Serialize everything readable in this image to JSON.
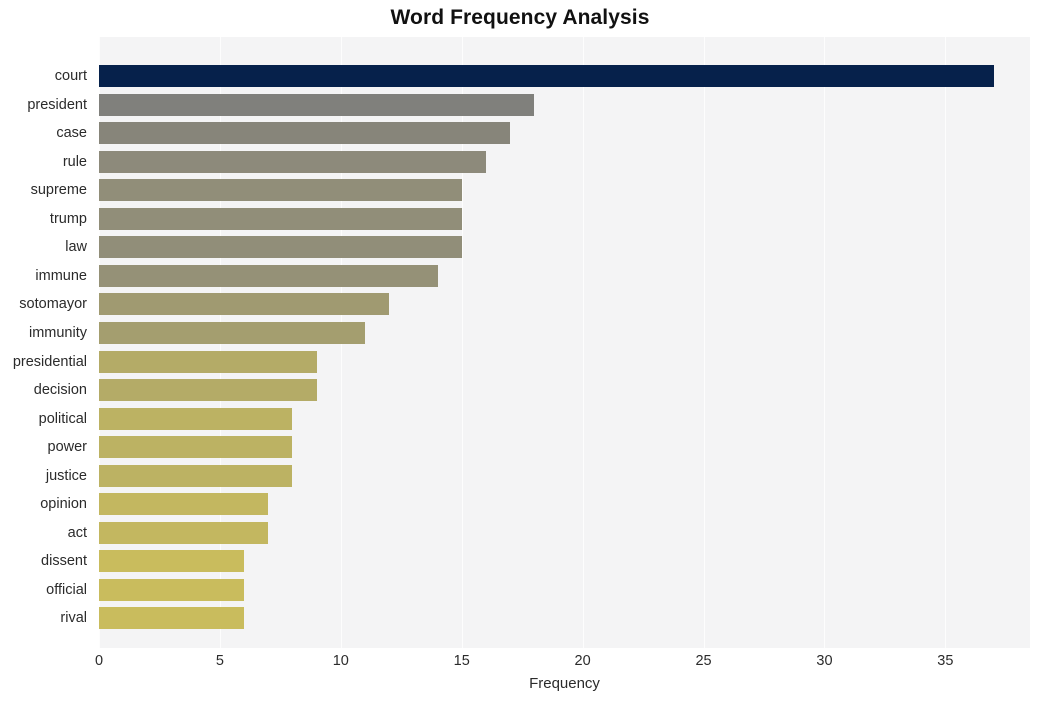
{
  "chart_data": {
    "type": "bar",
    "orientation": "horizontal",
    "title": "Word Frequency Analysis",
    "xlabel": "Frequency",
    "ylabel": "",
    "categories": [
      "court",
      "president",
      "case",
      "rule",
      "supreme",
      "trump",
      "law",
      "immune",
      "sotomayor",
      "immunity",
      "presidential",
      "decision",
      "political",
      "power",
      "justice",
      "opinion",
      "act",
      "dissent",
      "official",
      "rival"
    ],
    "values": [
      37,
      18,
      17,
      16,
      15,
      15,
      15,
      14,
      12,
      11,
      9,
      9,
      8,
      8,
      8,
      7,
      7,
      6,
      6,
      6
    ],
    "bar_colors": [
      "#06214b",
      "#80807c",
      "#87857a",
      "#8d8a7b",
      "#918e79",
      "#918e79",
      "#918e79",
      "#959177",
      "#a09a71",
      "#a49e6f",
      "#b4ab67",
      "#b4ab67",
      "#bcb263",
      "#bcb263",
      "#bcb263",
      "#c3b760",
      "#c3b760",
      "#c9bc5d",
      "#c9bc5d",
      "#c9bc5d"
    ],
    "xlim": [
      0,
      38.5
    ],
    "xticks": [
      0,
      5,
      10,
      15,
      20,
      25,
      30,
      35
    ],
    "xtick_labels": [
      "0",
      "5",
      "10",
      "15",
      "20",
      "25",
      "30",
      "35"
    ],
    "grid": true,
    "grid_axis": "x",
    "grid_color": "#fdfdfd",
    "plot_background": "#f4f4f5",
    "figure_background": "#ffffff",
    "legend": null
  }
}
